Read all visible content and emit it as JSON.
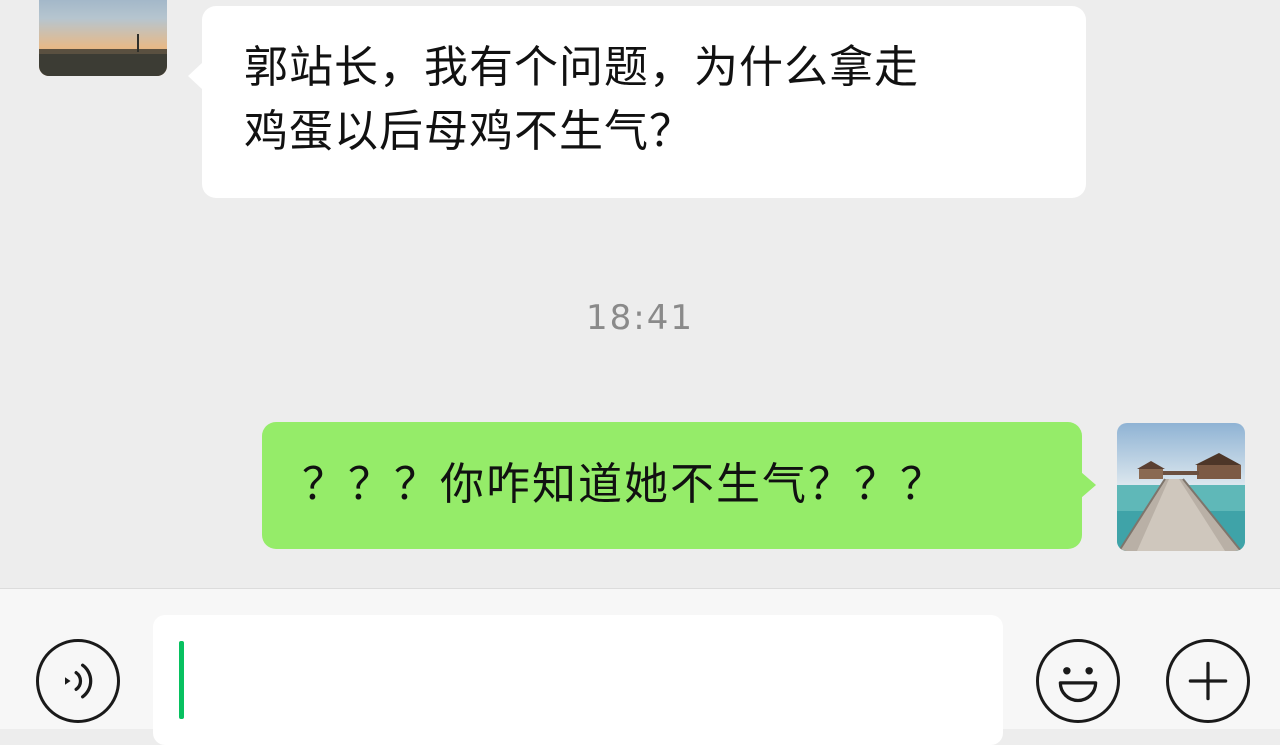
{
  "messages": [
    {
      "direction": "incoming",
      "lines": [
        "郭站长，我有个问题，为什么拿走",
        "鸡蛋以后母鸡不生气？"
      ]
    },
    {
      "direction": "outgoing",
      "text": "？？？你咋知道她不生气？？？"
    }
  ],
  "timestamp": "18:41",
  "input": {
    "value": ""
  },
  "icons": {
    "voice": "voice-icon",
    "emoji": "emoji-icon",
    "plus": "plus-icon"
  },
  "colors": {
    "outgoing_bubble": "#95ec69",
    "incoming_bubble": "#ffffff",
    "background": "#ededed",
    "caret": "#07c160"
  }
}
